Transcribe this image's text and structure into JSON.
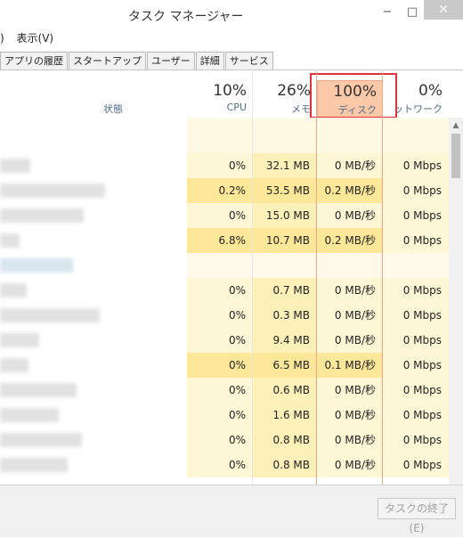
{
  "window": {
    "title": "タスク マネージャー",
    "minimize": "−",
    "maximize": "□",
    "close": "✕"
  },
  "menu": {
    "items": [
      ")",
      "表示(V)"
    ]
  },
  "tabs": [
    "アプリの履歴",
    "スタートアップ",
    "ユーザー",
    "詳細",
    "サービス"
  ],
  "columns": {
    "status": "状態",
    "cpu": {
      "pct": "10%",
      "label": "CPU"
    },
    "mem": {
      "pct": "26%",
      "label": "メモ"
    },
    "disk": {
      "pct": "100%",
      "label": "ディスク"
    },
    "net": {
      "pct": "0%",
      "label": "ットワーク"
    }
  },
  "rows": [
    {
      "cpu": "0%",
      "mem": "32.1 MB",
      "disk": "0 MB/秒",
      "net": "0 Mbps",
      "hot": false
    },
    {
      "cpu": "0.2%",
      "mem": "53.5 MB",
      "disk": "0.2 MB/秒",
      "net": "0 Mbps",
      "hot": true
    },
    {
      "cpu": "0%",
      "mem": "15.0 MB",
      "disk": "0 MB/秒",
      "net": "0 Mbps",
      "hot": false
    },
    {
      "cpu": "6.8%",
      "mem": "10.7 MB",
      "disk": "0.2 MB/秒",
      "net": "0 Mbps",
      "hot": true
    },
    {
      "cpu": "",
      "mem": "",
      "disk": "",
      "net": "",
      "hot": false,
      "blank": true
    },
    {
      "cpu": "0%",
      "mem": "0.7 MB",
      "disk": "0 MB/秒",
      "net": "0 Mbps",
      "hot": false
    },
    {
      "cpu": "0%",
      "mem": "0.3 MB",
      "disk": "0 MB/秒",
      "net": "0 Mbps",
      "hot": false
    },
    {
      "cpu": "0%",
      "mem": "9.4 MB",
      "disk": "0 MB/秒",
      "net": "0 Mbps",
      "hot": false
    },
    {
      "cpu": "0%",
      "mem": "6.5 MB",
      "disk": "0.1 MB/秒",
      "net": "0 Mbps",
      "hot": true
    },
    {
      "cpu": "0%",
      "mem": "0.6 MB",
      "disk": "0 MB/秒",
      "net": "0 Mbps",
      "hot": false
    },
    {
      "cpu": "0%",
      "mem": "1.6 MB",
      "disk": "0 MB/秒",
      "net": "0 Mbps",
      "hot": false
    },
    {
      "cpu": "0%",
      "mem": "0.8 MB",
      "disk": "0 MB/秒",
      "net": "0 Mbps",
      "hot": false
    },
    {
      "cpu": "0%",
      "mem": "0.8 MB",
      "disk": "0 MB/秒",
      "net": "0 Mbps",
      "hot": false
    }
  ],
  "end_task": "タスクの終了(E)",
  "colors": {
    "cell_light": "#fef7d6",
    "cell_mid": "#fdf0b8",
    "cell_hot": "#fde89a",
    "disk_header": "#fbc8a8",
    "highlight": "#e0303a"
  }
}
